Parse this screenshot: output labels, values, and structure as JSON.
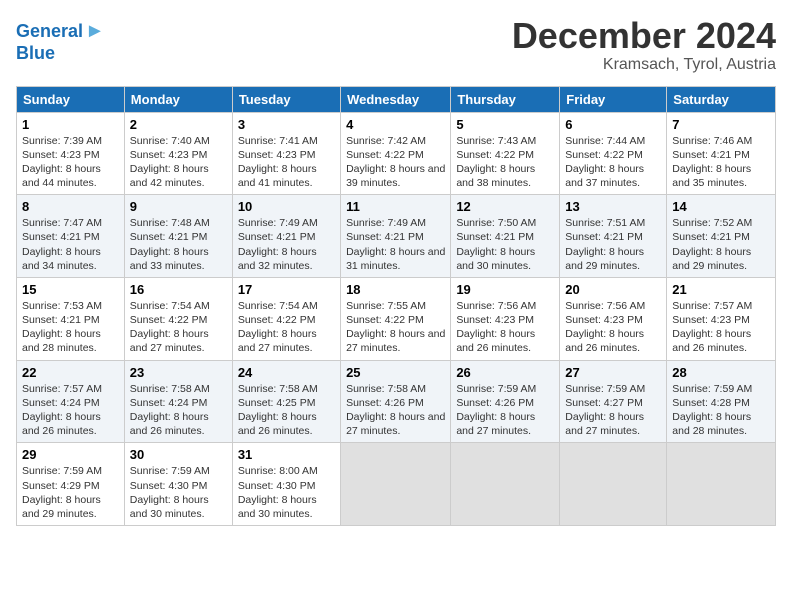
{
  "header": {
    "logo_line1": "General",
    "logo_line2": "Blue",
    "month": "December 2024",
    "location": "Kramsach, Tyrol, Austria"
  },
  "weekdays": [
    "Sunday",
    "Monday",
    "Tuesday",
    "Wednesday",
    "Thursday",
    "Friday",
    "Saturday"
  ],
  "weeks": [
    [
      {
        "day": "1",
        "sunrise": "Sunrise: 7:39 AM",
        "sunset": "Sunset: 4:23 PM",
        "daylight": "Daylight: 8 hours and 44 minutes."
      },
      {
        "day": "2",
        "sunrise": "Sunrise: 7:40 AM",
        "sunset": "Sunset: 4:23 PM",
        "daylight": "Daylight: 8 hours and 42 minutes."
      },
      {
        "day": "3",
        "sunrise": "Sunrise: 7:41 AM",
        "sunset": "Sunset: 4:23 PM",
        "daylight": "Daylight: 8 hours and 41 minutes."
      },
      {
        "day": "4",
        "sunrise": "Sunrise: 7:42 AM",
        "sunset": "Sunset: 4:22 PM",
        "daylight": "Daylight: 8 hours and 39 minutes."
      },
      {
        "day": "5",
        "sunrise": "Sunrise: 7:43 AM",
        "sunset": "Sunset: 4:22 PM",
        "daylight": "Daylight: 8 hours and 38 minutes."
      },
      {
        "day": "6",
        "sunrise": "Sunrise: 7:44 AM",
        "sunset": "Sunset: 4:22 PM",
        "daylight": "Daylight: 8 hours and 37 minutes."
      },
      {
        "day": "7",
        "sunrise": "Sunrise: 7:46 AM",
        "sunset": "Sunset: 4:21 PM",
        "daylight": "Daylight: 8 hours and 35 minutes."
      }
    ],
    [
      {
        "day": "8",
        "sunrise": "Sunrise: 7:47 AM",
        "sunset": "Sunset: 4:21 PM",
        "daylight": "Daylight: 8 hours and 34 minutes."
      },
      {
        "day": "9",
        "sunrise": "Sunrise: 7:48 AM",
        "sunset": "Sunset: 4:21 PM",
        "daylight": "Daylight: 8 hours and 33 minutes."
      },
      {
        "day": "10",
        "sunrise": "Sunrise: 7:49 AM",
        "sunset": "Sunset: 4:21 PM",
        "daylight": "Daylight: 8 hours and 32 minutes."
      },
      {
        "day": "11",
        "sunrise": "Sunrise: 7:49 AM",
        "sunset": "Sunset: 4:21 PM",
        "daylight": "Daylight: 8 hours and 31 minutes."
      },
      {
        "day": "12",
        "sunrise": "Sunrise: 7:50 AM",
        "sunset": "Sunset: 4:21 PM",
        "daylight": "Daylight: 8 hours and 30 minutes."
      },
      {
        "day": "13",
        "sunrise": "Sunrise: 7:51 AM",
        "sunset": "Sunset: 4:21 PM",
        "daylight": "Daylight: 8 hours and 29 minutes."
      },
      {
        "day": "14",
        "sunrise": "Sunrise: 7:52 AM",
        "sunset": "Sunset: 4:21 PM",
        "daylight": "Daylight: 8 hours and 29 minutes."
      }
    ],
    [
      {
        "day": "15",
        "sunrise": "Sunrise: 7:53 AM",
        "sunset": "Sunset: 4:21 PM",
        "daylight": "Daylight: 8 hours and 28 minutes."
      },
      {
        "day": "16",
        "sunrise": "Sunrise: 7:54 AM",
        "sunset": "Sunset: 4:22 PM",
        "daylight": "Daylight: 8 hours and 27 minutes."
      },
      {
        "day": "17",
        "sunrise": "Sunrise: 7:54 AM",
        "sunset": "Sunset: 4:22 PM",
        "daylight": "Daylight: 8 hours and 27 minutes."
      },
      {
        "day": "18",
        "sunrise": "Sunrise: 7:55 AM",
        "sunset": "Sunset: 4:22 PM",
        "daylight": "Daylight: 8 hours and 27 minutes."
      },
      {
        "day": "19",
        "sunrise": "Sunrise: 7:56 AM",
        "sunset": "Sunset: 4:23 PM",
        "daylight": "Daylight: 8 hours and 26 minutes."
      },
      {
        "day": "20",
        "sunrise": "Sunrise: 7:56 AM",
        "sunset": "Sunset: 4:23 PM",
        "daylight": "Daylight: 8 hours and 26 minutes."
      },
      {
        "day": "21",
        "sunrise": "Sunrise: 7:57 AM",
        "sunset": "Sunset: 4:23 PM",
        "daylight": "Daylight: 8 hours and 26 minutes."
      }
    ],
    [
      {
        "day": "22",
        "sunrise": "Sunrise: 7:57 AM",
        "sunset": "Sunset: 4:24 PM",
        "daylight": "Daylight: 8 hours and 26 minutes."
      },
      {
        "day": "23",
        "sunrise": "Sunrise: 7:58 AM",
        "sunset": "Sunset: 4:24 PM",
        "daylight": "Daylight: 8 hours and 26 minutes."
      },
      {
        "day": "24",
        "sunrise": "Sunrise: 7:58 AM",
        "sunset": "Sunset: 4:25 PM",
        "daylight": "Daylight: 8 hours and 26 minutes."
      },
      {
        "day": "25",
        "sunrise": "Sunrise: 7:58 AM",
        "sunset": "Sunset: 4:26 PM",
        "daylight": "Daylight: 8 hours and 27 minutes."
      },
      {
        "day": "26",
        "sunrise": "Sunrise: 7:59 AM",
        "sunset": "Sunset: 4:26 PM",
        "daylight": "Daylight: 8 hours and 27 minutes."
      },
      {
        "day": "27",
        "sunrise": "Sunrise: 7:59 AM",
        "sunset": "Sunset: 4:27 PM",
        "daylight": "Daylight: 8 hours and 27 minutes."
      },
      {
        "day": "28",
        "sunrise": "Sunrise: 7:59 AM",
        "sunset": "Sunset: 4:28 PM",
        "daylight": "Daylight: 8 hours and 28 minutes."
      }
    ],
    [
      {
        "day": "29",
        "sunrise": "Sunrise: 7:59 AM",
        "sunset": "Sunset: 4:29 PM",
        "daylight": "Daylight: 8 hours and 29 minutes."
      },
      {
        "day": "30",
        "sunrise": "Sunrise: 7:59 AM",
        "sunset": "Sunset: 4:30 PM",
        "daylight": "Daylight: 8 hours and 30 minutes."
      },
      {
        "day": "31",
        "sunrise": "Sunrise: 8:00 AM",
        "sunset": "Sunset: 4:30 PM",
        "daylight": "Daylight: 8 hours and 30 minutes."
      },
      {
        "day": "",
        "sunrise": "",
        "sunset": "",
        "daylight": ""
      },
      {
        "day": "",
        "sunrise": "",
        "sunset": "",
        "daylight": ""
      },
      {
        "day": "",
        "sunrise": "",
        "sunset": "",
        "daylight": ""
      },
      {
        "day": "",
        "sunrise": "",
        "sunset": "",
        "daylight": ""
      }
    ]
  ]
}
